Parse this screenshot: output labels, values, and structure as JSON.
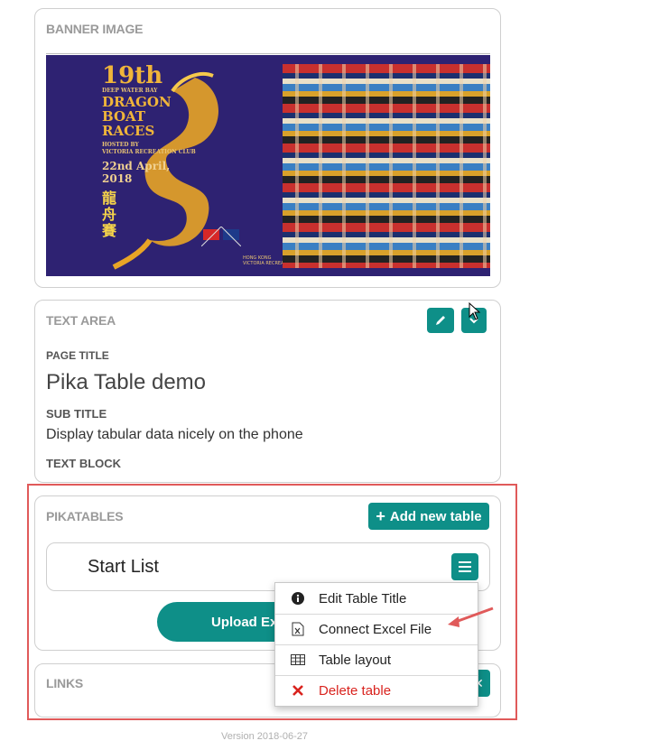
{
  "banner": {
    "label": "BANNER IMAGE",
    "image_text": {
      "line1": "19th",
      "line2": "DEEP WATER BAY",
      "line3": "DRAGON",
      "line4": "BOAT",
      "line5": "RACES",
      "hosted_by": "HOSTED BY",
      "club": "VICTORIA RECREATION CLUB",
      "date": "22nd April, 2018",
      "chinese": "龍舟賽",
      "footer1": "HONG KONG",
      "footer2": "VICTORIA RECREATION CLUB"
    }
  },
  "text_area": {
    "label": "TEXT AREA",
    "page_title_label": "PAGE TITLE",
    "page_title": "Pika Table demo",
    "sub_title_label": "SUB TITLE",
    "sub_title": "Display tabular data nicely on the phone",
    "text_block_label": "TEXT BLOCK"
  },
  "pikatables": {
    "label": "PIKATABLES",
    "add_button": "Add new table",
    "table_title": "Start List",
    "upload_button": "Upload Ex"
  },
  "links": {
    "label": "LINKS"
  },
  "dropdown": {
    "items": [
      {
        "label": "Edit Table Title",
        "icon": "info-circle-icon"
      },
      {
        "label": "Connect Excel File",
        "icon": "excel-file-icon"
      },
      {
        "label": "Table layout",
        "icon": "table-grid-icon"
      },
      {
        "label": "Delete table",
        "icon": "delete-x-icon",
        "color": "#d9231e"
      }
    ]
  },
  "footer": {
    "version": "Version 2018-06-27"
  },
  "colors": {
    "accent": "#0e8f88",
    "highlight": "#e05a5a",
    "danger": "#d9231e"
  }
}
